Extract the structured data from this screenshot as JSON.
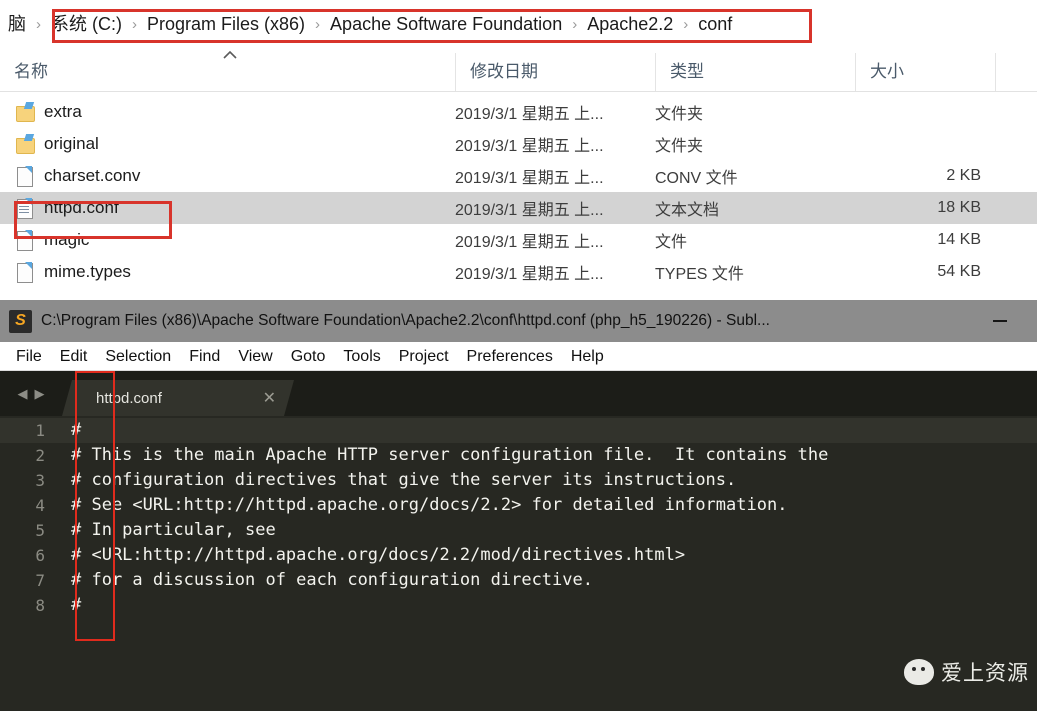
{
  "explorer": {
    "breadcrumb": {
      "items": [
        "脑",
        "系统 (C:)",
        "Program Files (x86)",
        "Apache Software Foundation",
        "Apache2.2",
        "conf"
      ],
      "separator": "›"
    },
    "columns": [
      {
        "key": "name",
        "label": "名称"
      },
      {
        "key": "date",
        "label": "修改日期"
      },
      {
        "key": "type",
        "label": "类型"
      },
      {
        "key": "size",
        "label": "大小"
      }
    ],
    "sort_indicator": "chevron-up",
    "rows": [
      {
        "icon": "folder-icon",
        "name": "extra",
        "date": "2019/3/1 星期五 上...",
        "type": "文件夹",
        "size": "",
        "selected": false
      },
      {
        "icon": "folder-icon",
        "name": "original",
        "date": "2019/3/1 星期五 上...",
        "type": "文件夹",
        "size": "",
        "selected": false
      },
      {
        "icon": "file-icon",
        "name": "charset.conv",
        "date": "2019/3/1 星期五 上...",
        "type": "CONV 文件",
        "size": "2 KB",
        "selected": false
      },
      {
        "icon": "text-document-icon",
        "name": "httpd.conf",
        "date": "2019/3/1 星期五 上...",
        "type": "文本文档",
        "size": "18 KB",
        "selected": true
      },
      {
        "icon": "file-icon",
        "name": "magic",
        "date": "2019/3/1 星期五 上...",
        "type": "文件",
        "size": "14 KB",
        "selected": false
      },
      {
        "icon": "file-icon",
        "name": "mime.types",
        "date": "2019/3/1 星期五 上...",
        "type": "TYPES 文件",
        "size": "54 KB",
        "selected": false
      }
    ],
    "annotations": {
      "breadcrumb_box_color": "#d8342b",
      "httpd_box_color": "#d8342b"
    }
  },
  "sublime": {
    "title": "C:\\Program Files (x86)\\Apache Software Foundation\\Apache2.2\\conf\\httpd.conf (php_h5_190226) - Subl...",
    "app_icon_letter": "S",
    "app_icon_color": "#f6a623",
    "window_controls": {
      "minimize": "−"
    },
    "menu": [
      "File",
      "Edit",
      "Selection",
      "Find",
      "View",
      "Goto",
      "Tools",
      "Project",
      "Preferences",
      "Help"
    ],
    "tab_nav": {
      "prev": "◀",
      "next": "▶"
    },
    "tabs": [
      {
        "label": "httpd.conf",
        "close": "✕",
        "active": true
      }
    ],
    "code_lines": [
      {
        "num": "1",
        "text": "#",
        "active": true
      },
      {
        "num": "2",
        "text": "# This is the main Apache HTTP server configuration file.  It contains the",
        "active": false
      },
      {
        "num": "3",
        "text": "# configuration directives that give the server its instructions.",
        "active": false
      },
      {
        "num": "4",
        "text": "# See <URL:http://httpd.apache.org/docs/2.2> for detailed information.",
        "active": false
      },
      {
        "num": "5",
        "text": "# In particular, see",
        "active": false
      },
      {
        "num": "6",
        "text": "# <URL:http://httpd.apache.org/docs/2.2/mod/directives.html>",
        "active": false
      },
      {
        "num": "7",
        "text": "# for a discussion of each configuration directive.",
        "active": false
      },
      {
        "num": "8",
        "text": "#",
        "active": false
      }
    ],
    "annotations": {
      "gutter_box_color": "#e02b1d"
    }
  },
  "watermark": {
    "icon": "wechat-icon",
    "text": "爱上资源"
  }
}
